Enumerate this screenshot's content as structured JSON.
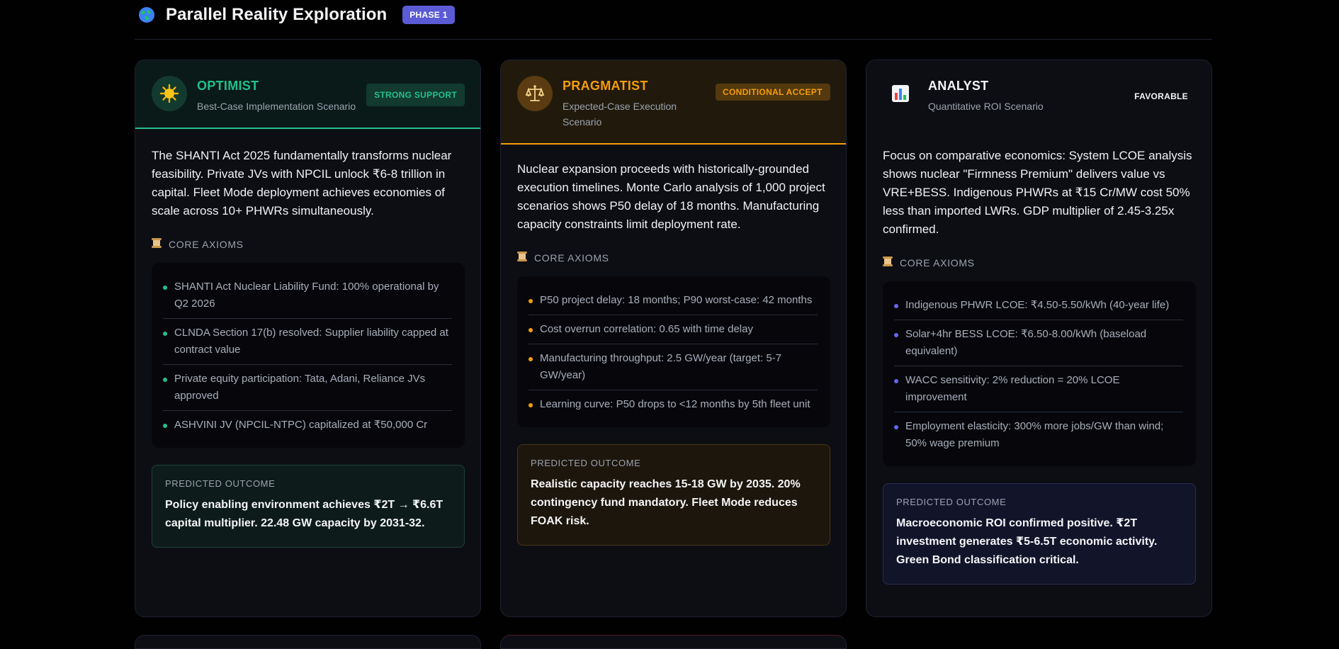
{
  "header": {
    "title": "Parallel Reality Exploration",
    "phase": "PHASE 1"
  },
  "cards": [
    {
      "role": "OPTIMIST",
      "subtitle": "Best-Case Implementation Scenario",
      "verdict": "STRONG SUPPORT",
      "description": "The SHANTI Act 2025 fundamentally transforms nuclear feasibility. Private JVs with NPCIL unlock ₹6-8 trillion in capital. Fleet Mode deployment achieves economies of scale across 10+ PHWRs simultaneously.",
      "axioms_label": "CORE AXIOMS",
      "axioms": [
        "SHANTI Act Nuclear Liability Fund: 100% operational by Q2 2026",
        "CLNDA Section 17(b) resolved: Supplier liability capped at contract value",
        "Private equity participation: Tata, Adani, Reliance JVs approved",
        "ASHVINI JV (NPCIL-NTPC) capitalized at ₹50,000 Cr"
      ],
      "outcome_label": "PREDICTED OUTCOME",
      "outcome": "Policy enabling environment achieves ₹2T → ₹6.6T capital multiplier. 22.48 GW capacity by 2031-32."
    },
    {
      "role": "PRAGMATIST",
      "subtitle": "Expected-Case Execution Scenario",
      "verdict": "CONDITIONAL ACCEPT",
      "description": "Nuclear expansion proceeds with historically-grounded execution timelines. Monte Carlo analysis of 1,000 project scenarios shows P50 delay of 18 months. Manufacturing capacity constraints limit deployment rate.",
      "axioms_label": "CORE AXIOMS",
      "axioms": [
        "P50 project delay: 18 months; P90 worst-case: 42 months",
        "Cost overrun correlation: 0.65 with time delay",
        "Manufacturing throughput: 2.5 GW/year (target: 5-7 GW/year)",
        "Learning curve: P50 drops to <12 months by 5th fleet unit"
      ],
      "outcome_label": "PREDICTED OUTCOME",
      "outcome": "Realistic capacity reaches 15-18 GW by 2035. 20% contingency fund mandatory. Fleet Mode reduces FOAK risk."
    },
    {
      "role": "ANALYST",
      "subtitle": "Quantitative ROI Scenario",
      "verdict": "FAVORABLE",
      "description": "Focus on comparative economics: System LCOE analysis shows nuclear \"Firmness Premium\" delivers value vs VRE+BESS. Indigenous PHWRs at ₹15 Cr/MW cost 50% less than imported LWRs. GDP multiplier of 2.45-3.25x confirmed.",
      "axioms_label": "CORE AXIOMS",
      "axioms": [
        "Indigenous PHWR LCOE: ₹4.50-5.50/kWh (40-year life)",
        "Solar+4hr BESS LCOE: ₹6.50-8.00/kWh (baseload equivalent)",
        "WACC sensitivity: 2% reduction = 20% LCOE improvement",
        "Employment elasticity: 300% more jobs/GW than wind; 50% wage premium"
      ],
      "outcome_label": "PREDICTED OUTCOME",
      "outcome": "Macroeconomic ROI confirmed positive. ₹2T investment generates ₹5-6.5T economic activity. Green Bond classification critical."
    }
  ],
  "colors": {
    "optimist": "#22c08a",
    "pragmatist": "#f59e0b",
    "analyst": "#6366f1",
    "phase_badge": "#5b5bd6"
  },
  "icons": {
    "header": "globe-icon",
    "optimist": "sun-icon",
    "pragmatist": "balance-scale-icon",
    "analyst": "bar-chart-icon",
    "axioms": "scroll-icon"
  }
}
